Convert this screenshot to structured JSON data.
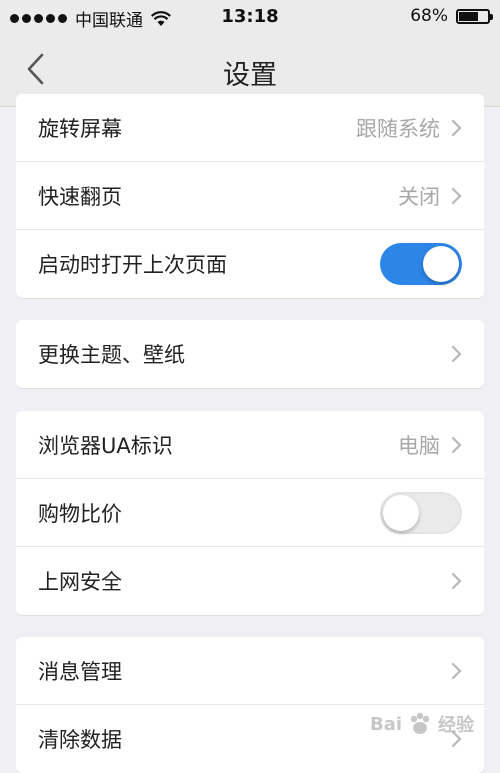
{
  "status_bar": {
    "carrier": "中国联通",
    "time": "13:18",
    "battery_percent": "68%",
    "battery_level": 0.68,
    "signal_bars": 5
  },
  "nav": {
    "title": "设置",
    "back_icon": "chevron-left-icon"
  },
  "groups": [
    {
      "rows": [
        {
          "label": "旋转屏幕",
          "value": "跟随系统",
          "control": "chevron"
        },
        {
          "label": "快速翻页",
          "value": "关闭",
          "control": "chevron"
        },
        {
          "label": "启动时打开上次页面",
          "value": "",
          "control": "toggle",
          "toggle_on": true
        }
      ]
    },
    {
      "rows": [
        {
          "label": "更换主题、壁纸",
          "value": "",
          "control": "chevron"
        }
      ]
    },
    {
      "rows": [
        {
          "label": "浏览器UA标识",
          "value": "电脑",
          "control": "chevron"
        },
        {
          "label": "购物比价",
          "value": "",
          "control": "toggle",
          "toggle_on": false
        },
        {
          "label": "上网安全",
          "value": "",
          "control": "chevron"
        }
      ]
    },
    {
      "rows": [
        {
          "label": "消息管理",
          "value": "",
          "control": "chevron"
        },
        {
          "label": "清除数据",
          "value": "",
          "control": "chevron"
        }
      ]
    }
  ],
  "watermark": {
    "text_left": "Bai",
    "text_right": "经验"
  },
  "colors": {
    "accent": "#2d85e8",
    "background": "#efeff4",
    "value_text": "#a8a8a8"
  }
}
